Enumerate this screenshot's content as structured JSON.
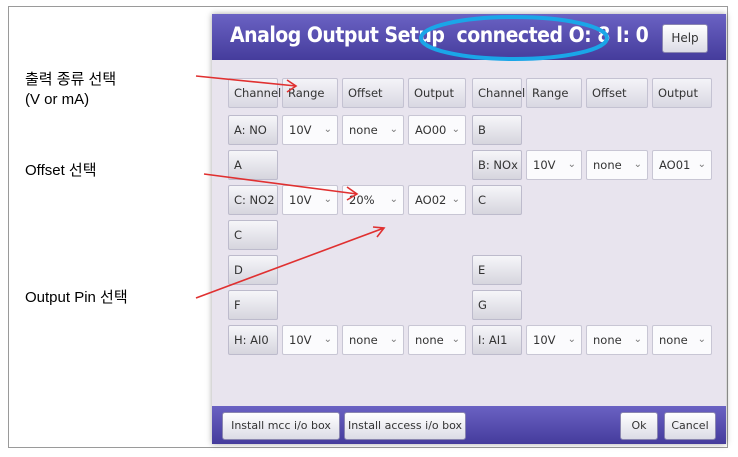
{
  "annotations": {
    "range_line1": "출력 종류 선택",
    "range_line2": "(V or mA)",
    "offset": "Offset 선택",
    "output_pin": "Output Pin 선택"
  },
  "dialog": {
    "title": "Analog Output Setup",
    "status": "connected O: 8 I: 0",
    "help": "Help",
    "headers": [
      "Channel",
      "Range",
      "Offset",
      "Output",
      "Channel",
      "Range",
      "Offset",
      "Output"
    ],
    "rows": [
      {
        "left": {
          "channel": "A: NO",
          "range": "10V",
          "offset": "none",
          "output": "AO00"
        },
        "right": {
          "channel": "B"
        }
      },
      {
        "left": {
          "channel": "A"
        },
        "right": {
          "channel": "B: NOx",
          "range": "10V",
          "offset": "none",
          "output": "AO01"
        }
      },
      {
        "left": {
          "channel": "C: NO2",
          "range": "10V",
          "offset": "20%",
          "output": "AO02"
        },
        "right": {
          "channel": "C"
        }
      },
      {
        "left": {
          "channel": "C"
        },
        "right": {}
      },
      {
        "left": {
          "channel": "D"
        },
        "right": {
          "channel": "E"
        }
      },
      {
        "left": {
          "channel": "F"
        },
        "right": {
          "channel": "G"
        }
      },
      {
        "left": {
          "channel": "H: AI0",
          "range": "10V",
          "offset": "none",
          "output": "none"
        },
        "right": {
          "channel": "I: AI1",
          "range": "10V",
          "offset": "none",
          "output": "none"
        }
      }
    ],
    "footer": {
      "install_mcc": "Install mcc i/o box",
      "install_access": "Install access i/o box",
      "ok": "Ok",
      "cancel": "Cancel"
    }
  },
  "colors": {
    "arrow": "#e03030",
    "highlight_ellipse": "#1aa6e8",
    "titlebar": "#4b43a6"
  }
}
